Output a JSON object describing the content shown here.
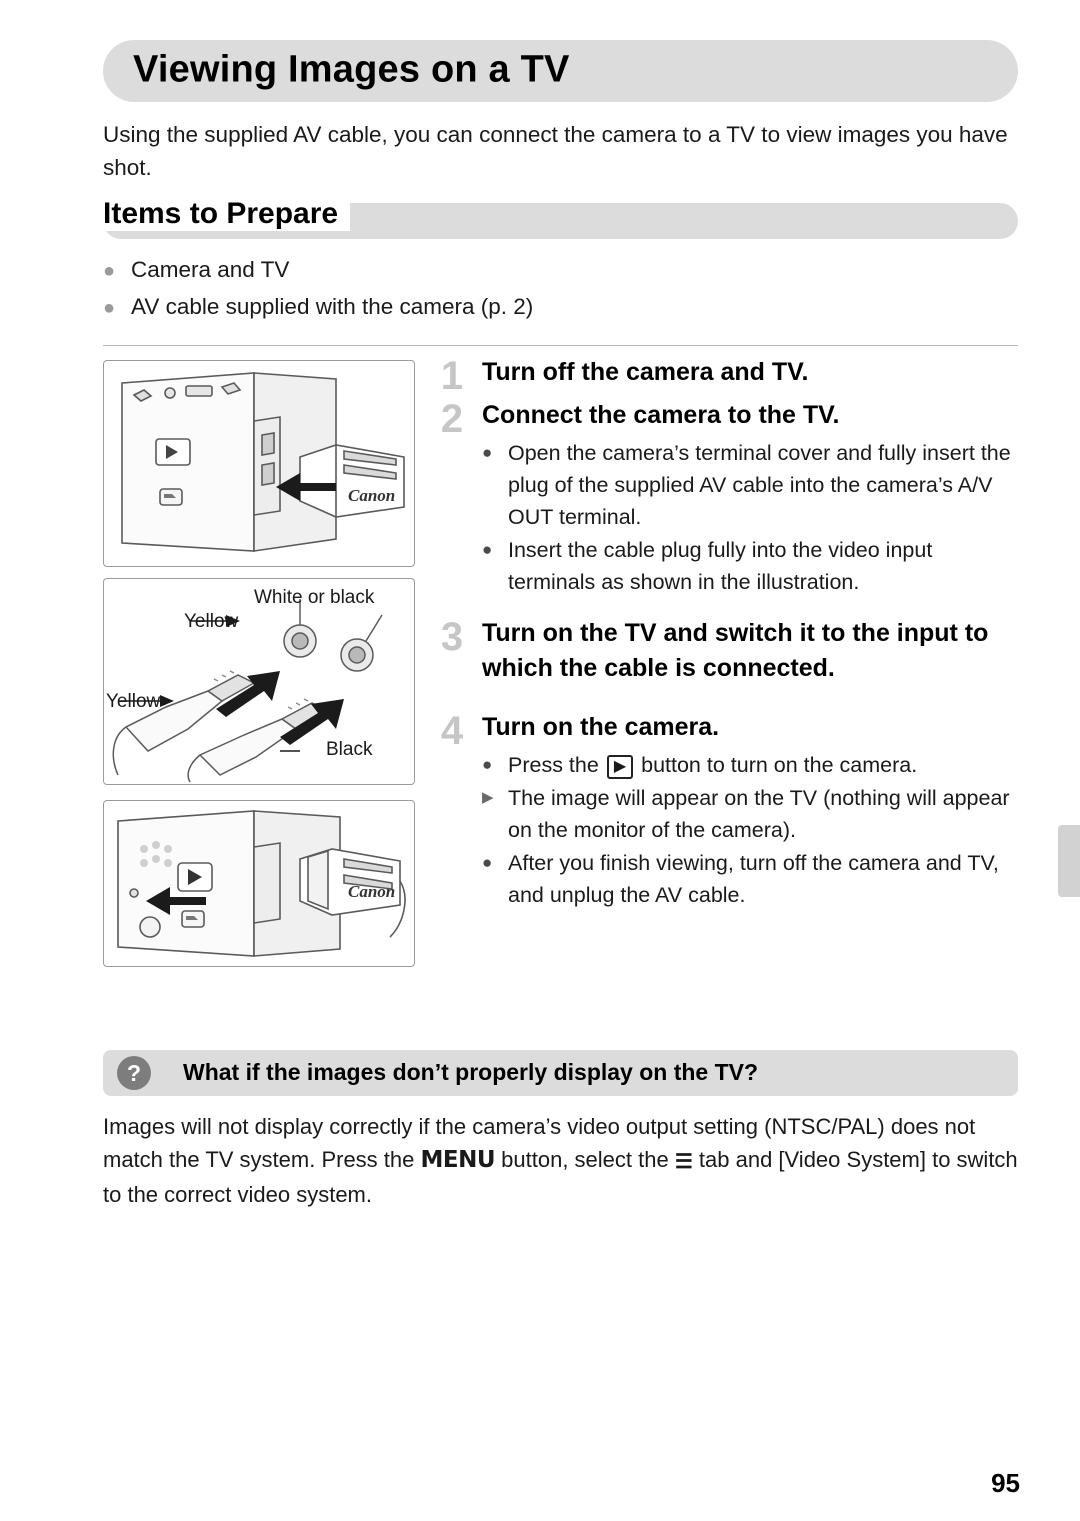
{
  "header": {
    "title": "Viewing Images on a TV"
  },
  "intro": "Using the supplied AV cable, you can connect the camera to a TV to view images you have shot.",
  "section": {
    "heading": "Items to Prepare",
    "items": [
      "Camera and TV",
      "AV cable supplied with the camera (p. 2)"
    ]
  },
  "steps": [
    {
      "num": "1",
      "title": "Turn off the camera and TV.",
      "bullets": []
    },
    {
      "num": "2",
      "title": "Connect the camera to the TV.",
      "bullets": [
        {
          "mark": "●",
          "text": "Open the camera’s terminal cover and fully insert the plug of the supplied AV cable into the camera’s A/V OUT terminal."
        },
        {
          "mark": "●",
          "text": "Insert the cable plug fully into the video input terminals as shown in the illustration."
        }
      ]
    },
    {
      "num": "3",
      "title": "Turn on the TV and switch it to the input to which the cable is connected.",
      "bullets": []
    },
    {
      "num": "4",
      "title": "Turn on the camera.",
      "bullets": [
        {
          "mark": "●",
          "text_before": "Press the",
          "icon": "playback-icon",
          "text_after": "button to turn on the camera."
        },
        {
          "mark": "▶",
          "text": "The image will appear on the TV (nothing will appear on the monitor of the camera)."
        },
        {
          "mark": "●",
          "text": "After you finish viewing, turn off the camera and TV, and unplug the AV cable."
        }
      ]
    }
  ],
  "tip": {
    "title": "What if the images don’t properly display on the TV?",
    "marker": "?",
    "body_part1": "Images will not display correctly if the camera’s video output setting (NTSC/PAL) does not match the TV system. Press the",
    "menu_label": "MENU",
    "body_part2": "button, select the",
    "tool_icon": "☰",
    "body_part3": "tab and [Video System] to switch to the correct video system."
  },
  "figures": {
    "terminal": {
      "name": "camera-terminal-illustration",
      "brand": "Canon"
    },
    "plugs": {
      "name": "av-plugs-illustration",
      "labels": {
        "white_or_black": "White or black",
        "yellow_top": "Yellow",
        "yellow_bottom": "Yellow",
        "black": "Black"
      }
    },
    "playback": {
      "name": "camera-playback-button-illustration",
      "brand": "Canon"
    }
  },
  "footer": {
    "page_number": "95"
  }
}
